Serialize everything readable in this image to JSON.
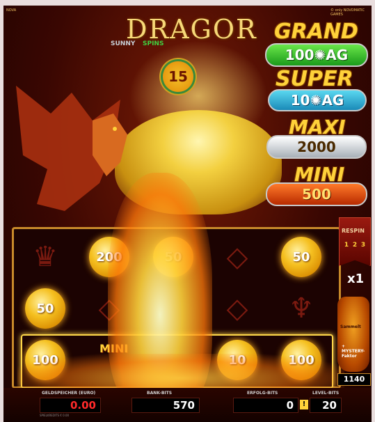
{
  "header": {
    "left_tiny": "NOVA",
    "right_tiny": "© only NOVOMATIC GAMES"
  },
  "logo": {
    "title": "DRAGOR",
    "sub_left": "SUNNY",
    "sub_right": "SPINS"
  },
  "free_spins": "15",
  "jackpots": {
    "grand": {
      "label": "GRAND",
      "value": "100✺AG"
    },
    "super": {
      "label": "SUPER",
      "value": "10✺AG"
    },
    "maxi": {
      "label": "MAXI",
      "value": "2000"
    },
    "mini": {
      "label": "MINI",
      "value": "500"
    }
  },
  "reels": {
    "row1": [
      "",
      "200",
      "50",
      "",
      "50"
    ],
    "row2": [
      "50",
      "",
      "",
      "",
      ""
    ],
    "row3": [
      "100",
      "",
      "",
      "10",
      "100"
    ],
    "mini_label": "MINI"
  },
  "side": {
    "respin_label": "RESPIN",
    "respin_steps": [
      "1",
      "2",
      "3"
    ],
    "multiplier": "x1",
    "vase_top": "Sammelt",
    "vase_bottom": "+ MYSTERY-Faktor",
    "vase_counter": "1140"
  },
  "bottom": {
    "geldspeicher_label": "GELDSPEICHER (EURO)",
    "geldspeicher_value": "0.00",
    "geldspeicher_sub": "SPIELKREDITS € 0.00",
    "bank_label": "BANK-BITS",
    "bank_value": "570",
    "erfolg_label": "ERFOLG-BITS",
    "erfolg_value": "0",
    "level_label": "LEVEL-BITS",
    "level_value": "20"
  }
}
